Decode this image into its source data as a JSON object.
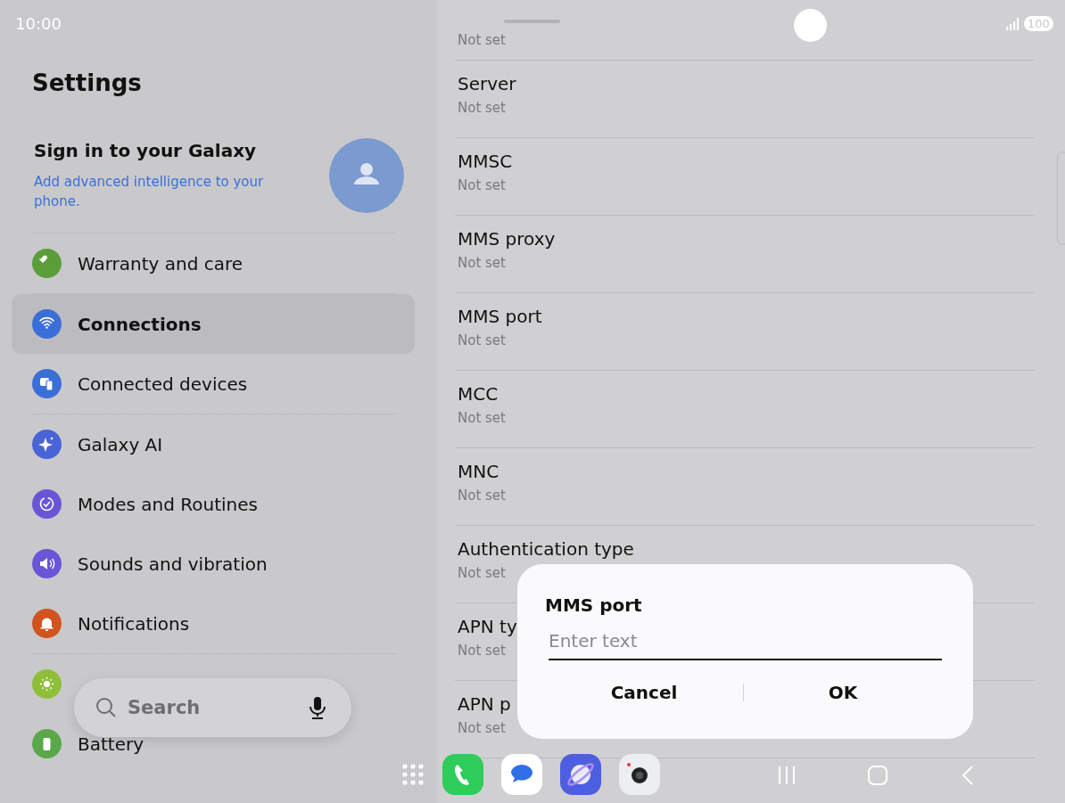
{
  "status_bar": {
    "time": "10:00",
    "battery": "100"
  },
  "sidebar": {
    "title": "Settings",
    "account": {
      "title": "Sign in to your Galaxy",
      "subtitle": "Add advanced intelligence to your phone."
    },
    "items": [
      {
        "label": "Warranty and care",
        "color": "#5a9e3a",
        "selected": false
      },
      {
        "label": "Connections",
        "color": "#3b6fd8",
        "selected": true
      },
      {
        "label": "Connected devices",
        "color": "#3b6fd8",
        "selected": false
      },
      {
        "label": "Galaxy AI",
        "color": "#4a63d6",
        "selected": false
      },
      {
        "label": "Modes and Routines",
        "color": "#6a55d6",
        "selected": false
      },
      {
        "label": "Sounds and vibration",
        "color": "#6a55d6",
        "selected": false
      },
      {
        "label": "Notifications",
        "color": "#d0541f",
        "selected": false
      },
      {
        "color": "#8fbf3a",
        "selected": false
      },
      {
        "label": "Battery",
        "color": "#5aa84a",
        "selected": false
      }
    ]
  },
  "search": {
    "placeholder": "Search"
  },
  "apn_fields": [
    {
      "value": "Not set"
    },
    {
      "title": "Server",
      "value": "Not set"
    },
    {
      "title": "MMSC",
      "value": "Not set"
    },
    {
      "title": "MMS proxy",
      "value": "Not set"
    },
    {
      "title": "MMS port",
      "value": "Not set"
    },
    {
      "title": "MCC",
      "value": "Not set"
    },
    {
      "title": "MNC",
      "value": "Not set"
    },
    {
      "title": "Authentication type",
      "value": "Not set"
    },
    {
      "title": "APN ty",
      "value": "Not set"
    },
    {
      "title": "APN p",
      "value": "Not set"
    }
  ],
  "dialog": {
    "title": "MMS port",
    "placeholder": "Enter text",
    "buttons": [
      "Cancel",
      "OK"
    ]
  }
}
